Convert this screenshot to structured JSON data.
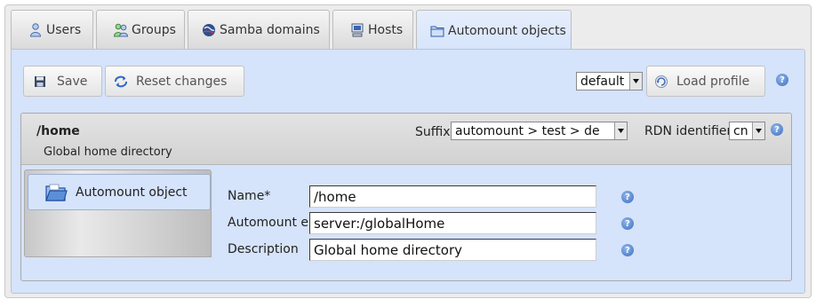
{
  "tabs": [
    {
      "label": "Users",
      "icon": "users-icon"
    },
    {
      "label": "Groups",
      "icon": "groups-icon"
    },
    {
      "label": "Samba domains",
      "icon": "samba-globe-icon"
    },
    {
      "label": "Hosts",
      "icon": "host-computer-icon"
    },
    {
      "label": "Automount objects",
      "icon": "folder-icon",
      "active": true
    }
  ],
  "toolbar": {
    "save_label": "Save",
    "reset_label": "Reset changes",
    "profile_value": "default",
    "load_profile_label": "Load profile"
  },
  "entry": {
    "title": "/home",
    "subtitle": "Global home directory",
    "suffix_label": "Suffix",
    "suffix_value": "automount > test > de",
    "rdn_label": "RDN identifier",
    "rdn_value": "cn"
  },
  "sidebar": {
    "items": [
      {
        "label": "Automount object",
        "icon": "automount-folder-icon"
      }
    ]
  },
  "form": {
    "name_label": "Name*",
    "name_value": "/home",
    "automount_label": "Automount entry*",
    "automount_value": "server:/globalHome",
    "description_label": "Description",
    "description_value": "Global home directory"
  },
  "colors": {
    "panel_bg": "#d5e3fb",
    "help_icon": "#3d6fc0"
  }
}
